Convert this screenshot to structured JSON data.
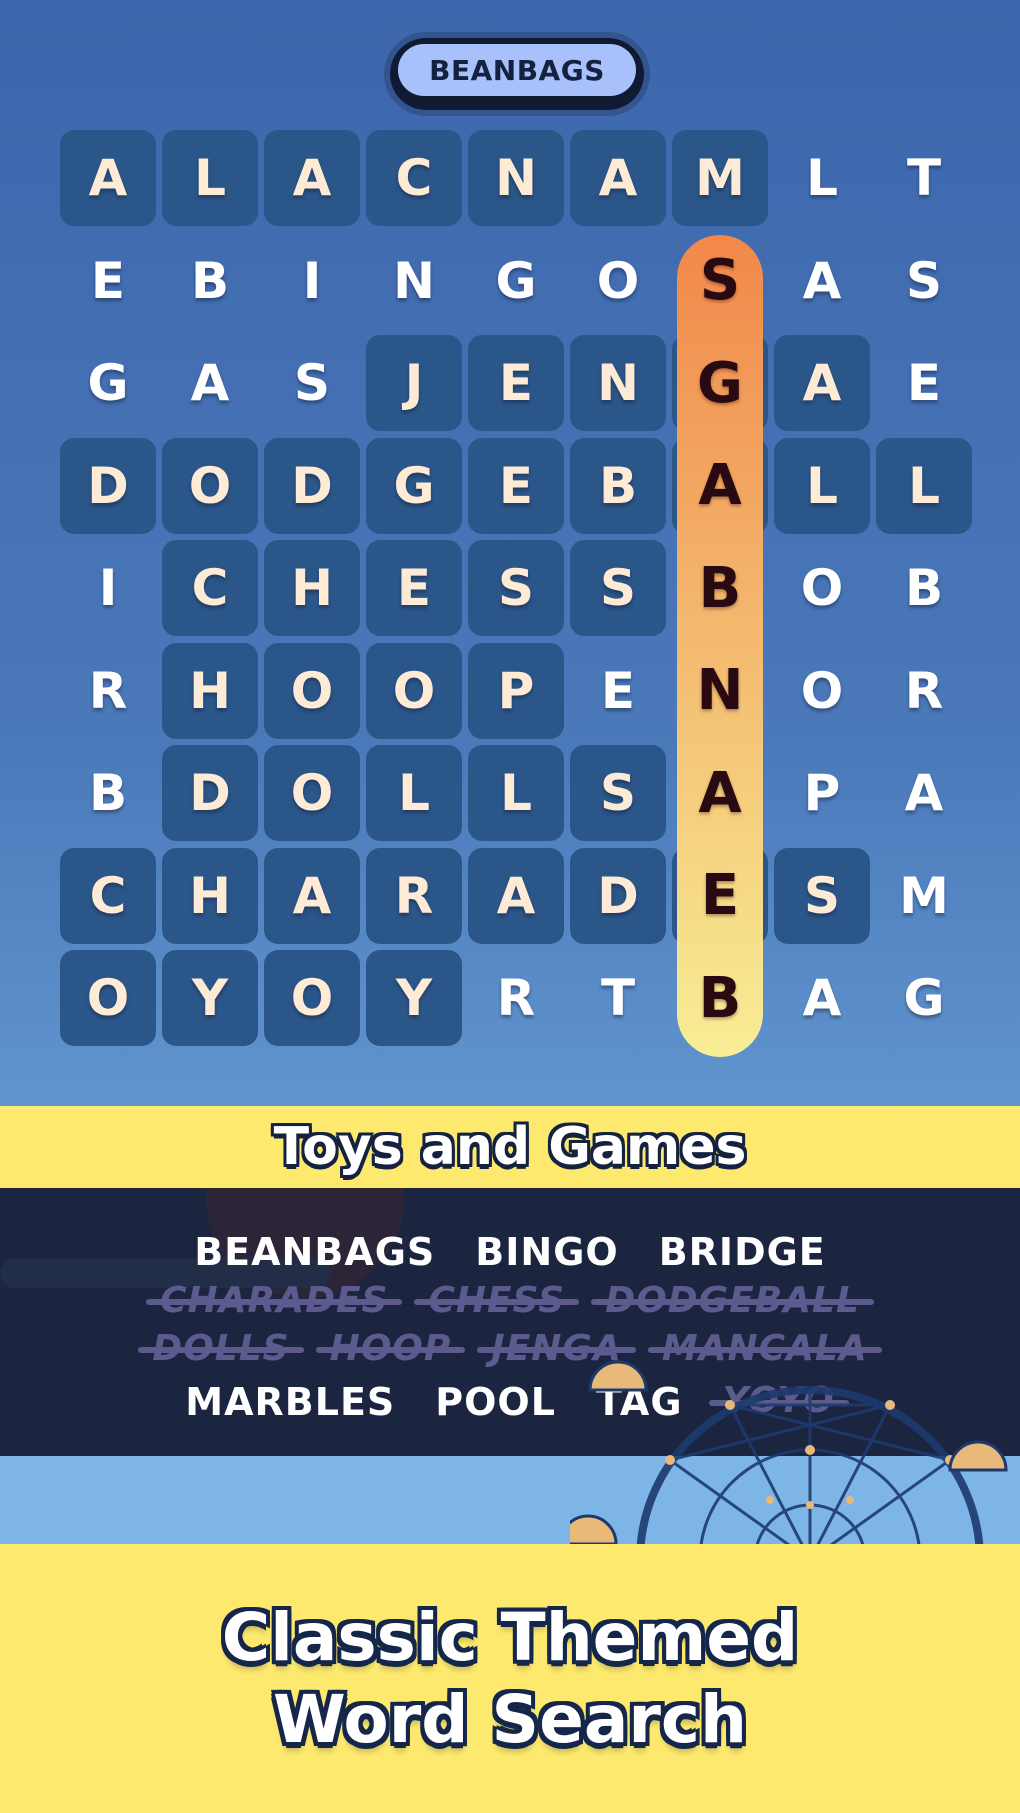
{
  "current_word": "BEANBAGS",
  "grid": {
    "rows": [
      [
        "A",
        "L",
        "A",
        "C",
        "N",
        "A",
        "M",
        "L",
        "T"
      ],
      [
        "E",
        "B",
        "I",
        "N",
        "G",
        "O",
        "S",
        "A",
        "S"
      ],
      [
        "G",
        "A",
        "S",
        "J",
        "E",
        "N",
        "G",
        "A",
        "E"
      ],
      [
        "D",
        "O",
        "D",
        "G",
        "E",
        "B",
        "A",
        "L",
        "L"
      ],
      [
        "I",
        "C",
        "H",
        "E",
        "S",
        "S",
        "B",
        "O",
        "B"
      ],
      [
        "R",
        "H",
        "O",
        "O",
        "P",
        "E",
        "N",
        "O",
        "R"
      ],
      [
        "B",
        "D",
        "O",
        "L",
        "L",
        "S",
        "A",
        "P",
        "A"
      ],
      [
        "C",
        "H",
        "A",
        "R",
        "A",
        "D",
        "E",
        "S",
        "M"
      ],
      [
        "O",
        "Y",
        "O",
        "Y",
        "R",
        "T",
        "B",
        "A",
        "G"
      ]
    ],
    "found_mask": [
      [
        1,
        1,
        1,
        1,
        1,
        1,
        1,
        0,
        0
      ],
      [
        0,
        0,
        0,
        0,
        0,
        0,
        0,
        0,
        0
      ],
      [
        0,
        0,
        0,
        1,
        1,
        1,
        1,
        1,
        0
      ],
      [
        1,
        1,
        1,
        1,
        1,
        1,
        1,
        1,
        1
      ],
      [
        0,
        1,
        1,
        1,
        1,
        1,
        0,
        0,
        0
      ],
      [
        0,
        1,
        1,
        1,
        1,
        0,
        0,
        0,
        0
      ],
      [
        0,
        1,
        1,
        1,
        1,
        1,
        0,
        0,
        0
      ],
      [
        1,
        1,
        1,
        1,
        1,
        1,
        1,
        1,
        0
      ],
      [
        1,
        1,
        1,
        1,
        0,
        0,
        0,
        0,
        0
      ]
    ],
    "highlight": {
      "word": "BEANBAGS",
      "column": 6,
      "from_row": 8,
      "to_row": 1,
      "direction": "up"
    }
  },
  "category": "Toys and Games",
  "word_list": [
    [
      {
        "text": "BEANBAGS",
        "found": false
      },
      {
        "text": "BINGO",
        "found": false
      },
      {
        "text": "BRIDGE",
        "found": false
      }
    ],
    [
      {
        "text": "CHARADES",
        "found": true
      },
      {
        "text": "CHESS",
        "found": true
      },
      {
        "text": "DODGEBALL",
        "found": true
      }
    ],
    [
      {
        "text": "DOLLS",
        "found": true
      },
      {
        "text": "HOOP",
        "found": true
      },
      {
        "text": "JENGA",
        "found": true
      },
      {
        "text": "MANCALA",
        "found": true
      }
    ],
    [
      {
        "text": "MARBLES",
        "found": false
      },
      {
        "text": "POOL",
        "found": false
      },
      {
        "text": "TAG",
        "found": false
      },
      {
        "text": "YOYO",
        "found": true
      }
    ]
  ],
  "tagline": {
    "line1": "Classic Themed",
    "line2": "Word Search"
  },
  "colors": {
    "found_cell": "#2b5689",
    "highlight_top": "#f2884a",
    "highlight_bottom": "#f8ee95",
    "band_yellow": "#fde96e",
    "panel_dark": "#1b2540",
    "struck_word": "#5d5a8d"
  }
}
